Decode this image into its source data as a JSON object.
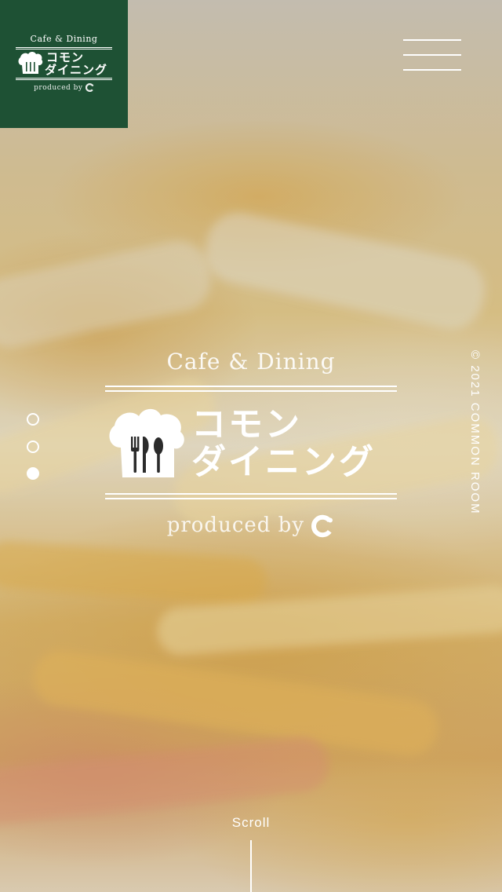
{
  "brand": {
    "subtitle": "Cafe & Dining",
    "name_line1": "コモン",
    "name_line2": "ダイニング",
    "produced_by": "produced by",
    "bg_color": "#1e5134"
  },
  "menu": {
    "icon": "hamburger-menu-icon"
  },
  "hero": {
    "subtitle": "Cafe & Dining",
    "name_line1": "コモン",
    "name_line2": "ダイニング",
    "produced_by": "produced by",
    "logo_icon": "chef-hat-cutlery-icon",
    "background_image": "pasta with grated cheese and pepper"
  },
  "slider": {
    "count": 3,
    "active_index": 2
  },
  "copyright": "© 2021 COMMON ROOM",
  "scroll": {
    "label": "Scroll"
  }
}
